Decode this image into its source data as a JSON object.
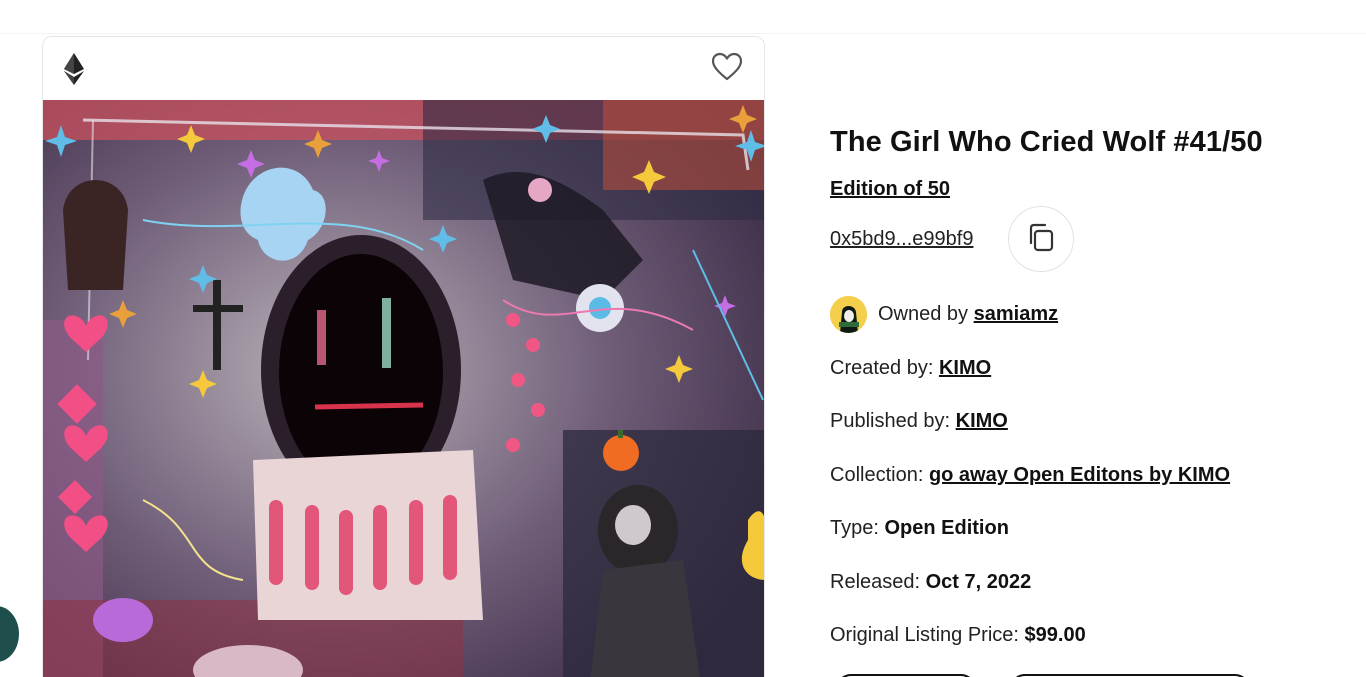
{
  "artwork": {
    "title": "The Girl Who Cried Wolf #41/50",
    "edition_label": "Edition of 50",
    "contract_address": "0x5bd9...e99bf9"
  },
  "icons": {
    "chain": "ethereum-icon",
    "favorite": "heart-icon",
    "copy": "copy-icon"
  },
  "owner": {
    "prefix": "Owned by",
    "username": "samiamz"
  },
  "details": {
    "created_by_label": "Created by:",
    "created_by": "KIMO",
    "published_by_label": "Published by:",
    "published_by": "KIMO",
    "collection_label": "Collection:",
    "collection": "go away Open Editons by KIMO",
    "type_label": "Type:",
    "type": "Open Edition",
    "released_label": "Released:",
    "released": "Oct 7, 2022",
    "price_label": "Original Listing Price:",
    "price": "$99.00"
  },
  "colors": {
    "fab": "#1f4f4d",
    "avatar_bg": "#f3cf4b"
  }
}
